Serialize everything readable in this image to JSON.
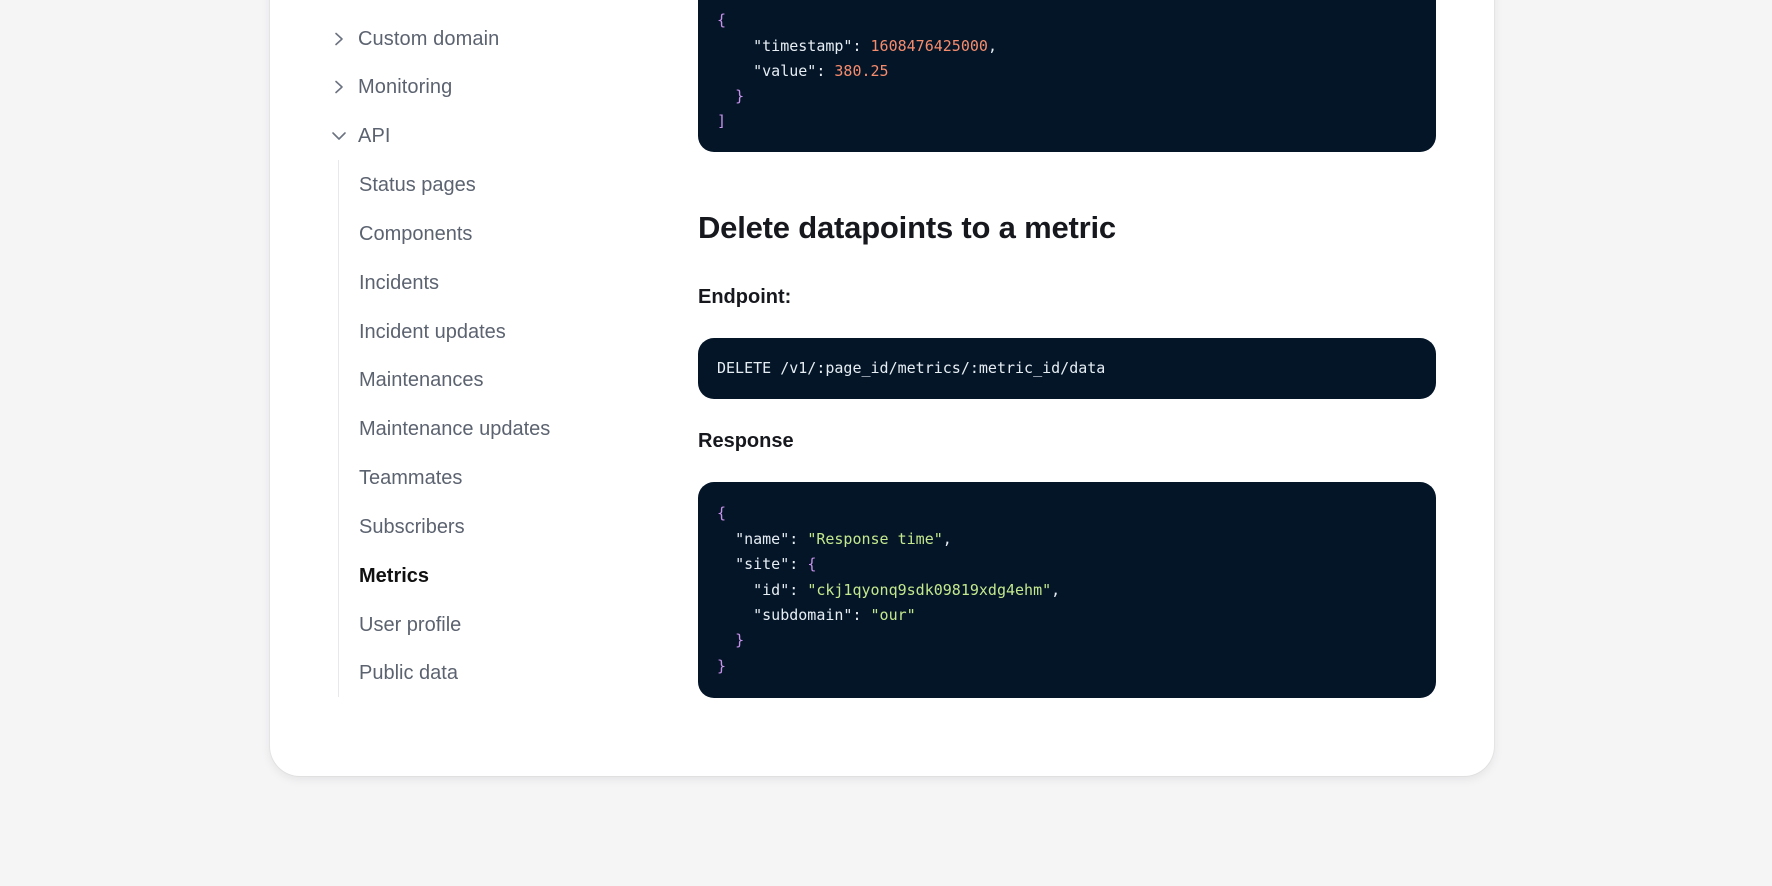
{
  "sidebar": {
    "sections": [
      {
        "label": "Custom domain",
        "expanded": false
      },
      {
        "label": "Monitoring",
        "expanded": false
      },
      {
        "label": "API",
        "expanded": true
      }
    ],
    "api_items": [
      {
        "label": "Status pages",
        "active": false
      },
      {
        "label": "Components",
        "active": false
      },
      {
        "label": "Incidents",
        "active": false
      },
      {
        "label": "Incident updates",
        "active": false
      },
      {
        "label": "Maintenances",
        "active": false
      },
      {
        "label": "Maintenance updates",
        "active": false
      },
      {
        "label": "Teammates",
        "active": false
      },
      {
        "label": "Subscribers",
        "active": false
      },
      {
        "label": "Metrics",
        "active": true
      },
      {
        "label": "User profile",
        "active": false
      },
      {
        "label": "Public data",
        "active": false
      }
    ]
  },
  "content": {
    "top_code": {
      "open_brace": "{",
      "timestamp_key": "\"timestamp\"",
      "timestamp_value": "1608476425000",
      "value_key": "\"value\"",
      "value_value": "380.25",
      "close_brace": "}",
      "close_bracket": "]"
    },
    "section_title": "Delete datapoints to a metric",
    "endpoint_label": "Endpoint:",
    "endpoint_code": "DELETE /v1/:page_id/metrics/:metric_id/data",
    "response_label": "Response",
    "response_code": {
      "open_brace": "{",
      "name_key": "\"name\"",
      "name_value": "\"Response time\"",
      "site_key": "\"site\"",
      "site_open": "{",
      "id_key": "\"id\"",
      "id_value": "\"ckj1qyonq9sdk09819xdg4ehm\"",
      "subdomain_key": "\"subdomain\"",
      "subdomain_value": "\"our\"",
      "site_close": "}",
      "close_brace": "}"
    }
  },
  "colors": {
    "page_bg": "#f5f5f6",
    "code_bg": "#041528",
    "punctuation": "#c792ea",
    "number": "#f78c6c",
    "string": "#c3e88d",
    "sidebar_text": "#5c6370",
    "active_text": "#111111"
  },
  "icons": {
    "collapsed": "chevron-right-icon",
    "expanded": "chevron-down-icon"
  }
}
